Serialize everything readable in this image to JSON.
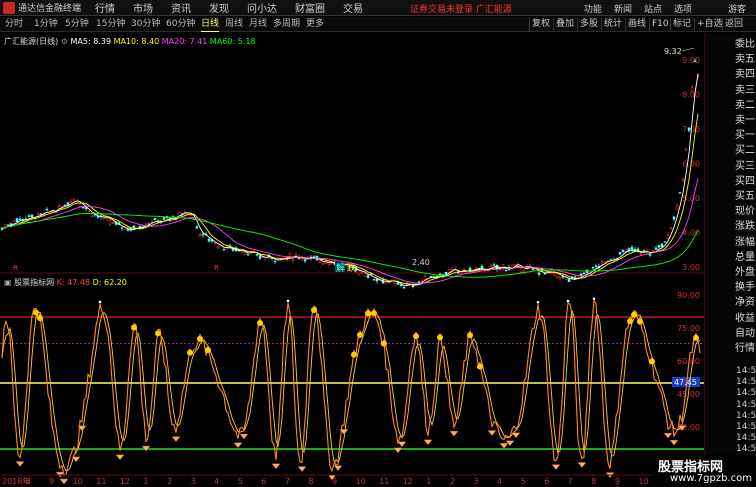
{
  "app": {
    "title": "通达信金融终端"
  },
  "menu": [
    "行情",
    "市场",
    "资讯",
    "发现",
    "问小达",
    "财富圈",
    "交易"
  ],
  "alert": "证券交易未登录 广汇能源",
  "right_menu": {
    "func": "功能",
    "news": "新闻",
    "site": "站点",
    "options": "选项",
    "guest": "游客"
  },
  "periods": [
    "分时",
    "1分钟",
    "5分钟",
    "15分钟",
    "30分钟",
    "60分钟",
    "日线",
    "周线",
    "月线",
    "多周期",
    "更多"
  ],
  "active_period": "日线",
  "tools": [
    "复权",
    "叠加",
    "多股",
    "统计",
    "画线",
    "F10",
    "标记",
    "+自选",
    "返回"
  ],
  "main_legend": {
    "name": "广汇能源(日线)",
    "ma5": "MA5: 8.39",
    "ma10": "MA10: 8.40",
    "ma20": "MA20: 7.41",
    "ma60": "MA60: 5.18",
    "colors": {
      "ma5": "#ffffff",
      "ma10": "#ffff00",
      "ma20": "#ff40ff",
      "ma60": "#00ff00"
    }
  },
  "price_axis": [
    "9.00",
    "8.00",
    "7.00",
    "6.00",
    "5.00",
    "4.00",
    "3.00"
  ],
  "price_marks": {
    "high": "9.32",
    "low": "2.40"
  },
  "events": {
    "e1": "解",
    "e2": "跌",
    "r1": "R",
    "r2": "R"
  },
  "indicator_legend": {
    "name": "股票指标网",
    "k": "K: 47.48",
    "d": "D: 62.20"
  },
  "indicator_axis": [
    "90.00",
    "75.00",
    "60.00",
    "45.00",
    "30.00",
    "15.00"
  ],
  "indicator_current": "47.45",
  "dates": [
    "2018年",
    "8",
    "9",
    "10",
    "11",
    "12",
    "1",
    "2",
    "3",
    "4",
    "5",
    "6",
    "7",
    "8",
    "9",
    "10",
    "11",
    "12",
    "1",
    "2",
    "3",
    "4",
    "5",
    "6",
    "7",
    "8",
    "9",
    "10",
    "11"
  ],
  "side_labels": [
    "委比",
    "卖五",
    "卖四",
    "卖三",
    "卖二",
    "卖一",
    "买一",
    "买二",
    "买三",
    "买四",
    "买五",
    "现价",
    "涨跌",
    "涨幅",
    "总量",
    "外盘",
    "换手",
    "净资",
    "收益",
    "自动",
    "行情"
  ],
  "side_times": [
    "14:56",
    "14:56",
    "14:56",
    "14:56",
    "14:56",
    "14:56",
    "14:56",
    "14:56",
    "14:56",
    "14:56",
    "14:56"
  ],
  "watermark": {
    "cn": "股票指标网",
    "url": "www.7gpzb.com"
  }
}
